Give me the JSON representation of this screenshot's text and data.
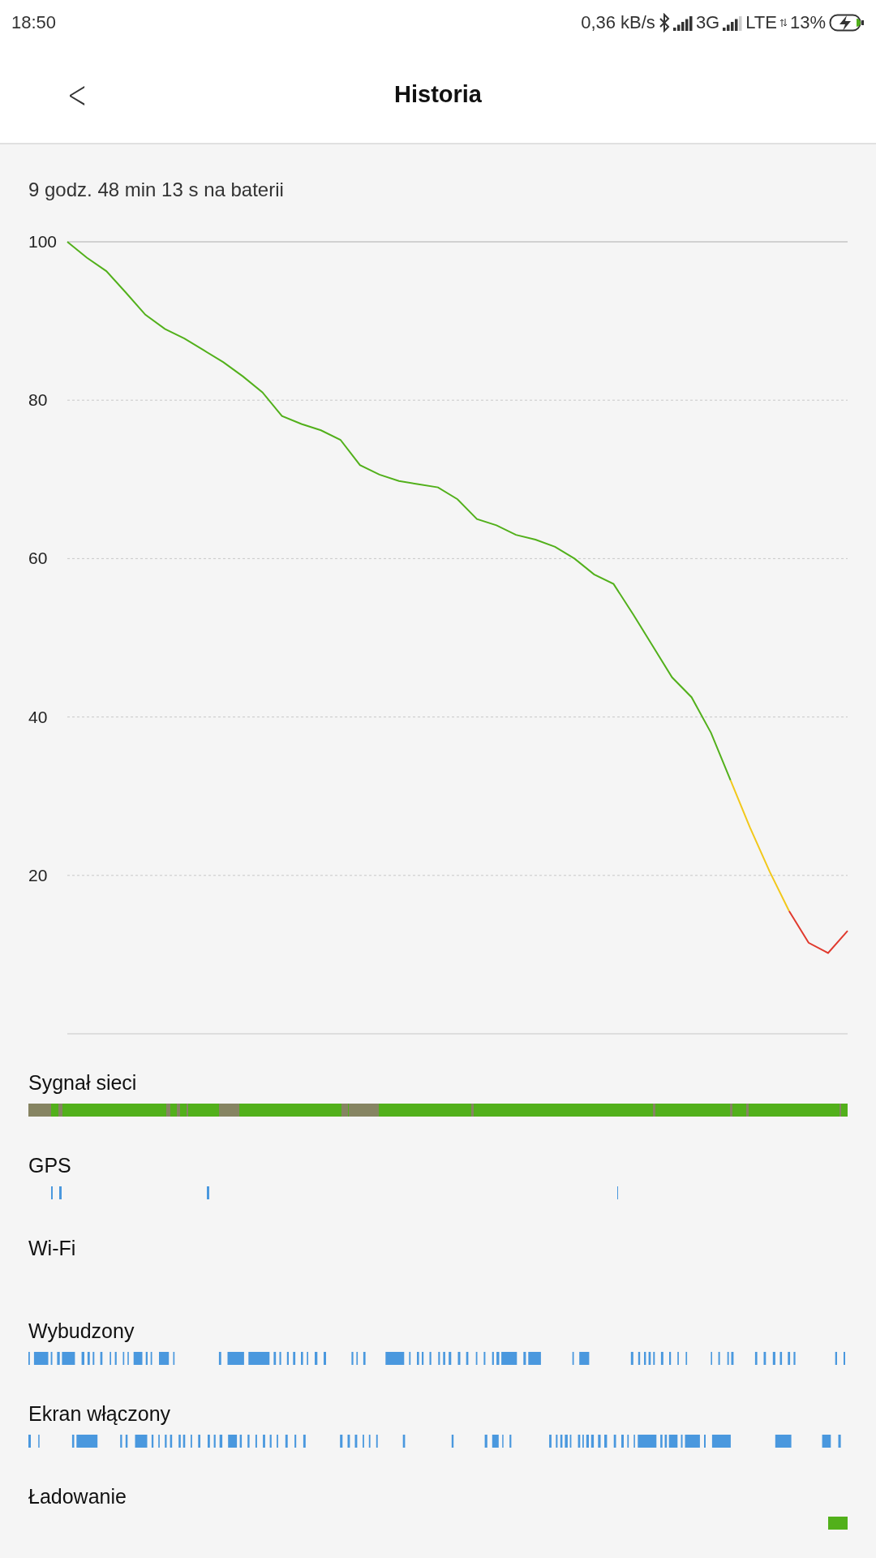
{
  "status_bar": {
    "time": "18:50",
    "speed": "0,36 kB/s",
    "network_1": "3G",
    "network_2": "LTE",
    "battery": "13%",
    "charging": true
  },
  "header": {
    "back": "<",
    "title": "Historia"
  },
  "summary": "9 godz. 48 min 13 s na baterii",
  "chart_data": {
    "type": "line",
    "grid": true,
    "ylim": [
      0,
      100
    ],
    "yticks": [
      20,
      40,
      60,
      80,
      100
    ],
    "series": [
      {
        "color": "#52b01b",
        "values": [
          100,
          98,
          96.3,
          93.6,
          90.8,
          89,
          87.8,
          86.3,
          84.8,
          83,
          81,
          78,
          77,
          76.2,
          75,
          71.8,
          70.6,
          69.8,
          69.4,
          69,
          67.5,
          65,
          64.2,
          63,
          62.4,
          61.5,
          60,
          58,
          56.8,
          53,
          49,
          45,
          42.5,
          38,
          32,
          null,
          null,
          null,
          null,
          null,
          null
        ]
      },
      {
        "color": "#f2c81a",
        "values": [
          null,
          null,
          null,
          null,
          null,
          null,
          null,
          null,
          null,
          null,
          null,
          null,
          null,
          null,
          null,
          null,
          null,
          null,
          null,
          null,
          null,
          null,
          null,
          null,
          null,
          null,
          null,
          null,
          null,
          null,
          null,
          null,
          null,
          null,
          32,
          26,
          20.5,
          15.5,
          null,
          null,
          null
        ]
      },
      {
        "color": "#e03a2e",
        "values": [
          null,
          null,
          null,
          null,
          null,
          null,
          null,
          null,
          null,
          null,
          null,
          null,
          null,
          null,
          null,
          null,
          null,
          null,
          null,
          null,
          null,
          null,
          null,
          null,
          null,
          null,
          null,
          null,
          null,
          null,
          null,
          null,
          null,
          null,
          null,
          null,
          null,
          15.5,
          11.5,
          10.2,
          13
        ]
      }
    ]
  },
  "tracks": [
    {
      "label": "Sygnał sieci",
      "kind": "signal"
    },
    {
      "label": "GPS",
      "kind": "sparse"
    },
    {
      "label": "Wi-Fi",
      "kind": "none"
    },
    {
      "label": "Wybudzony",
      "kind": "dense"
    },
    {
      "label": "Ekran włączony",
      "kind": "dense"
    },
    {
      "label": "Ładowanie",
      "kind": "charging"
    }
  ]
}
